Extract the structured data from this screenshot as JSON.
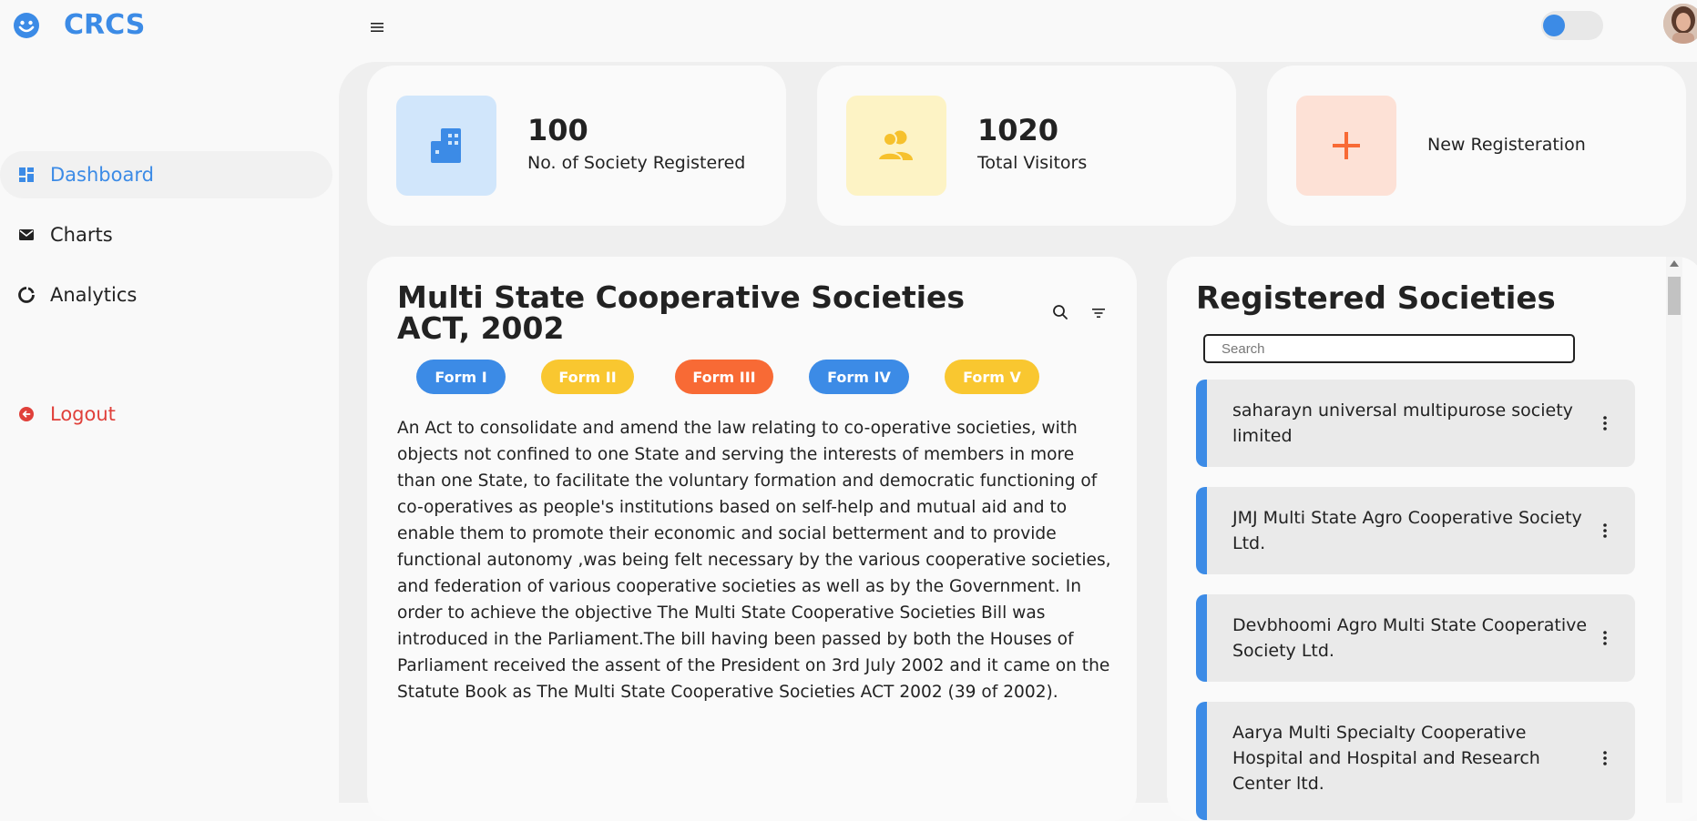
{
  "app": {
    "title": "CRCS"
  },
  "sidebar": {
    "items": [
      {
        "label": "Dashboard",
        "icon": "dashboard-icon",
        "active": true
      },
      {
        "label": "Charts",
        "icon": "mail-icon"
      },
      {
        "label": "Analytics",
        "icon": "donut-chart-icon"
      }
    ],
    "logout_label": "Logout"
  },
  "stats": [
    {
      "value": "100",
      "label": "No. of Society Registered",
      "icon": "building-icon",
      "bg": "#d1e6fb",
      "color": "#3c8be6"
    },
    {
      "value": "1020",
      "label": "Total Visitors",
      "icon": "users-icon",
      "bg": "#fdf3c5",
      "color": "#f6c12d"
    },
    {
      "value": "",
      "label": "New Registeration",
      "icon": "plus-icon",
      "bg": "#fde1d6",
      "color": "#f86a35"
    }
  ],
  "act": {
    "title": "Multi State Cooperative Societies ACT, 2002",
    "forms": [
      {
        "label": "Form I",
        "color": "#3c8be6"
      },
      {
        "label": "Form II",
        "color": "#f9c730"
      },
      {
        "label": "Form III",
        "color": "#f86a35"
      },
      {
        "label": "Form IV",
        "color": "#3c8be6"
      },
      {
        "label": "Form V",
        "color": "#f9c730"
      }
    ],
    "text": "An Act to consolidate and amend the law relating to co-operative societies, with objects not confined to one State and serving the interests of members in more than one State, to facilitate the voluntary formation and democratic functioning of co-operatives as people's institutions based on self-help and mutual aid and to enable them to promote their economic and social betterment and to provide functional autonomy ,was being felt necessary by the various cooperative societies, and federation of various cooperative societies as well as by the Government. In order to achieve the objective The Multi State Cooperative Societies Bill was introduced in the Parliament.The bill having been passed by both the Houses of Parliament received the assent of the President on 3rd July 2002 and it came on the Statute Book as The Multi State Cooperative Societies ACT 2002 (39 of 2002)."
  },
  "societies": {
    "title": "Registered Societies",
    "search_placeholder": "Search",
    "items": [
      "saharayn universal multipurose society limited",
      "JMJ Multi State Agro Cooperative Society Ltd.",
      "Devbhoomi Agro Multi State Cooperative Society Ltd.",
      "Aarya Multi Specialty Cooperative Hospital and Hospital and Research Center ltd."
    ]
  },
  "colors": {
    "accent": "#3c8be6",
    "logout": "#e0403a"
  }
}
